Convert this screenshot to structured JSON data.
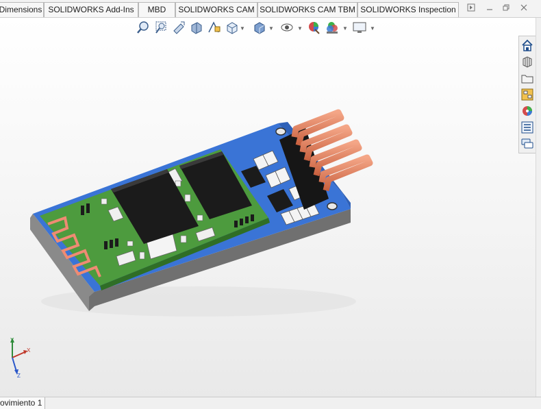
{
  "tabs": [
    {
      "label": "Dimensions"
    },
    {
      "label": "SOLIDWORKS Add-Ins"
    },
    {
      "label": "MBD"
    },
    {
      "label": "SOLIDWORKS CAM"
    },
    {
      "label": "SOLIDWORKS CAM TBM"
    },
    {
      "label": "SOLIDWORKS Inspection"
    }
  ],
  "heads_up_toolbar": {
    "icons": [
      "zoom-to-fit-icon",
      "zoom-to-area-icon",
      "previous-view-icon",
      "section-view-icon",
      "dynamic-annotation-icon",
      "view-orientation-icon",
      "display-style-icon",
      "hide-show-icon",
      "edit-appearance-icon",
      "apply-scene-icon",
      "view-settings-icon"
    ]
  },
  "task_pane": {
    "icons": [
      "home-icon",
      "design-library-icon",
      "file-explorer-icon",
      "view-palette-icon",
      "appearances-icon",
      "custom-properties-icon",
      "forum-icon"
    ]
  },
  "triad": {
    "x_label": "X",
    "y_label": "Y",
    "z_label": "Z"
  },
  "status": {
    "tab_label": "ovimiento 1"
  },
  "colors": {
    "board_blue": "#3a74d6",
    "pcb_green": "#4d9b3e",
    "copper": "#e08060",
    "chip_black": "#1b1b1b"
  }
}
